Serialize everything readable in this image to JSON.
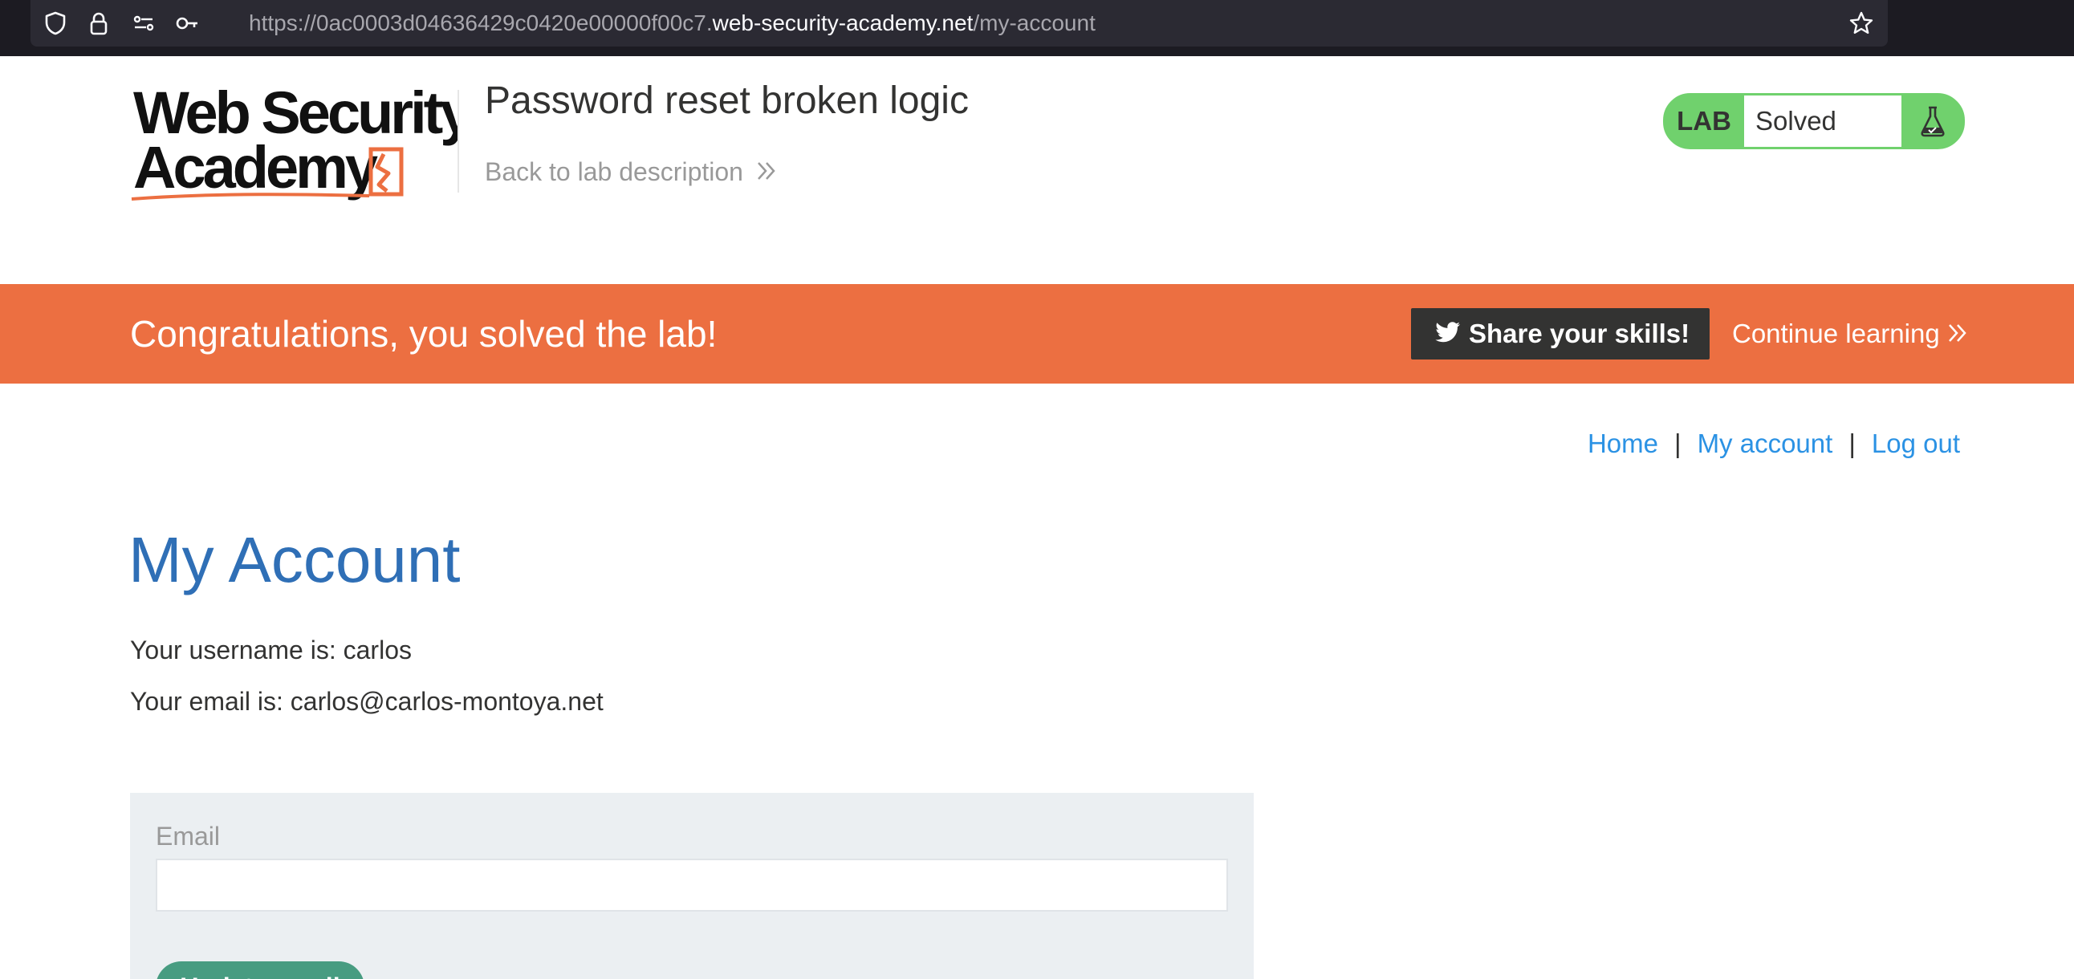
{
  "browser": {
    "url_prefix": "https://0ac0003d04636429c0420e00000f00c7.",
    "url_host": "web-security-academy.net",
    "url_path": "/my-account"
  },
  "header": {
    "logo_line1": "Web Security",
    "logo_line2": "Academy",
    "lab_title": "Password reset broken logic",
    "back_link": "Back to lab description",
    "lab_badge": "LAB",
    "lab_status": "Solved"
  },
  "banner": {
    "message": "Congratulations, you solved the lab!",
    "share_label": "Share your skills!",
    "continue_label": "Continue learning"
  },
  "nav": {
    "home": "Home",
    "separator": "|",
    "my_account": "My account",
    "log_out": "Log out"
  },
  "main": {
    "title": "My Account",
    "username_line": "Your username is: carlos",
    "email_line": "Your email is: carlos@carlos-montoya.net",
    "email_label": "Email",
    "email_value": "",
    "update_button": "Update email"
  },
  "colors": {
    "banner": "#ec6f41",
    "link": "#2b92e4",
    "title": "#2f6fb6",
    "lab_solved": "#70d16d",
    "button": "#479c81"
  }
}
